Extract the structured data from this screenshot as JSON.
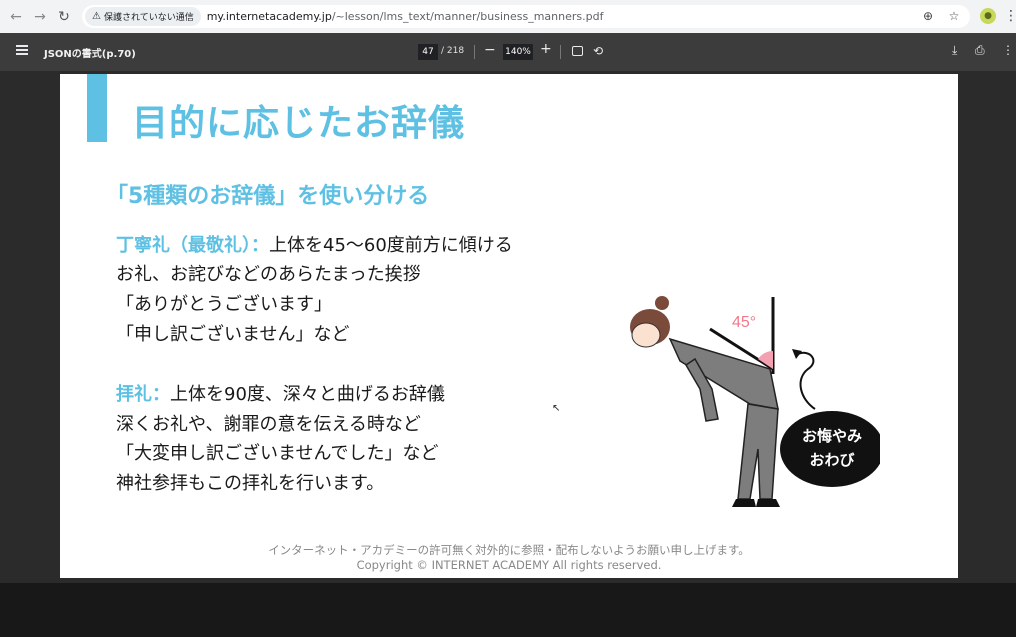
{
  "browser": {
    "security_label": "保護されていない通信",
    "url_host": "my.internetacademy.jp",
    "url_path": "/~lesson/lms_text/manner/business_manners.pdf"
  },
  "pdf_toolbar": {
    "doc_title": "JSONの書式(p.70)",
    "current_page": "47",
    "total_pages": "/ 218",
    "zoom": "140%"
  },
  "slide": {
    "title": "目的に応じたお辞儀",
    "subtitle": "「5種類のお辞儀」を使い分ける",
    "section1": {
      "key": "丁寧礼（最敬礼）：",
      "lead": "上体を45～60度前方に傾ける",
      "lines": [
        "お礼、お詫びなどのあらたまった挨拶",
        "「ありがとうございます」",
        "「申し訳ございません」など"
      ]
    },
    "section2": {
      "key": "拝礼：",
      "lead": "上体を90度、深々と曲げるお辞儀",
      "lines": [
        "深くお礼や、謝罪の意を伝える時など",
        "「大変申し訳ございませんでした」など",
        "神社参拝もこの拝礼を行います。"
      ]
    },
    "illustration": {
      "angle_label": "45°",
      "bubble_line1": "お悔やみ",
      "bubble_line2": "おわび"
    },
    "footer_line1": "インターネット・アカデミーの許可無く対外的に参照・配布しないようお願い申し上げます。",
    "footer_line2": "Copyright © INTERNET ACADEMY All rights reserved."
  },
  "colors": {
    "accent": "#5ec1e3",
    "toolbar": "#3c3c3c",
    "viewer": "#2b2b2b"
  }
}
